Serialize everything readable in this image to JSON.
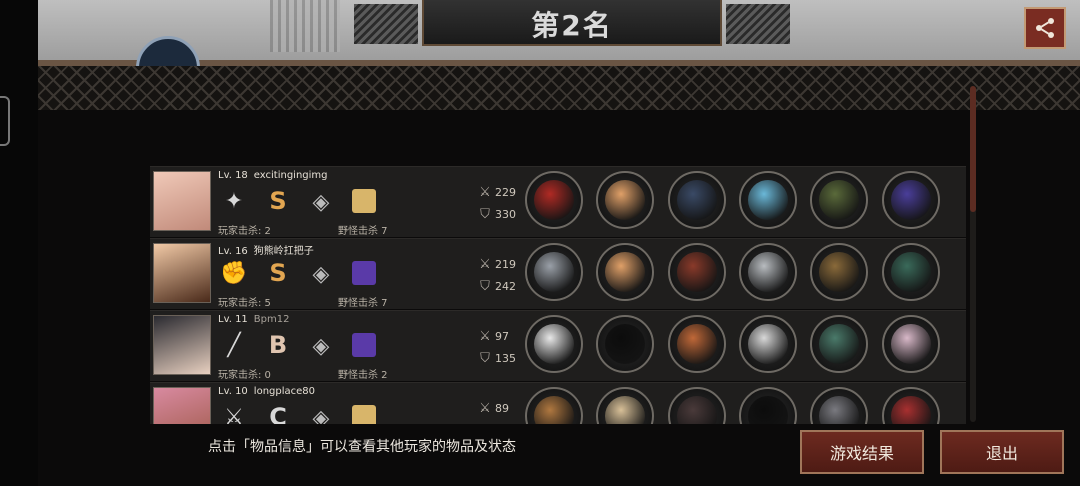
{
  "header": {
    "title": "第2名",
    "partial_name": ""
  },
  "players": [
    {
      "level": "Lv. 18",
      "name": "excitingingimg",
      "name_color": "#e6e0d6",
      "class_icon": "shuriken-icon",
      "grade": "S",
      "grade_color": "#e2a651",
      "kill_player": "玩家击杀: 2",
      "kill_monster": "野怪击杀 7",
      "attack": "229",
      "defense": "330",
      "portrait_colors": [
        "#f0c9b8",
        "#c18a7a"
      ],
      "tile_color": "#d8b56a",
      "items": [
        "#b02a24",
        "#e0a068",
        "#3a4a66",
        "#6ab8d8",
        "#5a6a3a",
        "#4a3e9a"
      ]
    },
    {
      "level": "Lv. 16",
      "name": "狗熊岭扛把子",
      "name_color": "#e6e0d6",
      "class_icon": "fist-icon",
      "grade": "S",
      "grade_color": "#e2a651",
      "kill_player": "玩家击杀: 5",
      "kill_monster": "野怪击杀 7",
      "attack": "219",
      "defense": "242",
      "portrait_colors": [
        "#f1c9a6",
        "#4a2a1a"
      ],
      "tile_color": "#5a3aa8",
      "items": [
        "#9aa0a8",
        "#e0a068",
        "#8a3a2a",
        "#b8bcc0",
        "#8a6a3a",
        "#3a6a5a"
      ]
    },
    {
      "level": "Lv. 11",
      "name": "Bpm12",
      "name_color": "#a8a29a",
      "class_icon": "bat-icon",
      "grade": "B",
      "grade_color": "#e0c5b0",
      "kill_player": "玩家击杀: 0",
      "kill_monster": "野怪击杀 2",
      "attack": "97",
      "defense": "135",
      "portrait_colors": [
        "#2a2a30",
        "#e8d0c0"
      ],
      "tile_color": "#5a3aa8",
      "items": [
        "#e8e8e8",
        "#0c0c0c",
        "#c06838",
        "#d8d8d8",
        "#4a7a6a",
        "#d8b8c8"
      ]
    },
    {
      "level": "Lv. 10",
      "name": "longplace80",
      "name_color": "#e6e0d6",
      "class_icon": "sword-icon",
      "grade": "C",
      "grade_color": "#d8d8d8",
      "kill_player": "",
      "kill_monster": "",
      "attack": "89",
      "defense": "",
      "portrait_colors": [
        "#d88aa0",
        "#a05a4a"
      ],
      "tile_color": "#d8b56a",
      "items": [
        "#b07840",
        "#d8c098",
        "#4a3a3a",
        "#0c0c0c",
        "#7a7a80",
        "#a83030"
      ]
    }
  ],
  "footer": {
    "hint": "点击「物品信息」可以查看其他玩家的物品及状态",
    "result_button": "游戏结果",
    "exit_button": "退出"
  },
  "colors": {
    "accent": "#7a2c22",
    "frame": "#a0765a"
  }
}
